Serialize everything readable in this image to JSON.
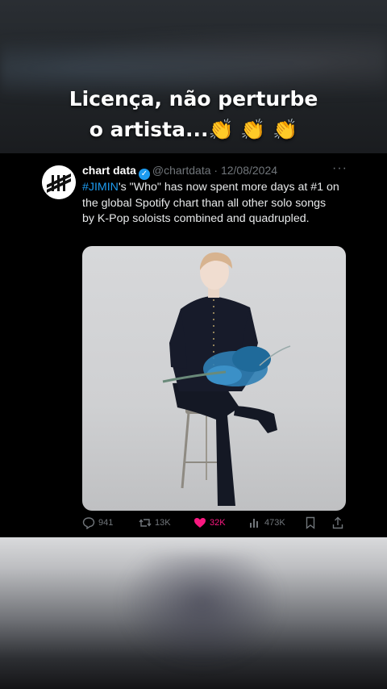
{
  "caption": {
    "line1": "Licença, não perturbe",
    "line2": "o artista...👏 👏 👏"
  },
  "tweet": {
    "author_name": "chart data",
    "verified_icon": "verified-badge-icon",
    "handle": "@chartdata",
    "date": "· 12/08/2024",
    "more_label": "···",
    "hashtag": "#JIMIN",
    "body": "'s \"Who\" has now spent more days at #1 on the global Spotify chart than all other solo songs by K-Pop soloists combined and quadrupled."
  },
  "actions": {
    "replies": "941",
    "retweets": "13K",
    "likes": "32K",
    "views": "473K"
  },
  "colors": {
    "accent": "#1d9bf0",
    "like": "#f91880",
    "muted": "#71767b"
  }
}
